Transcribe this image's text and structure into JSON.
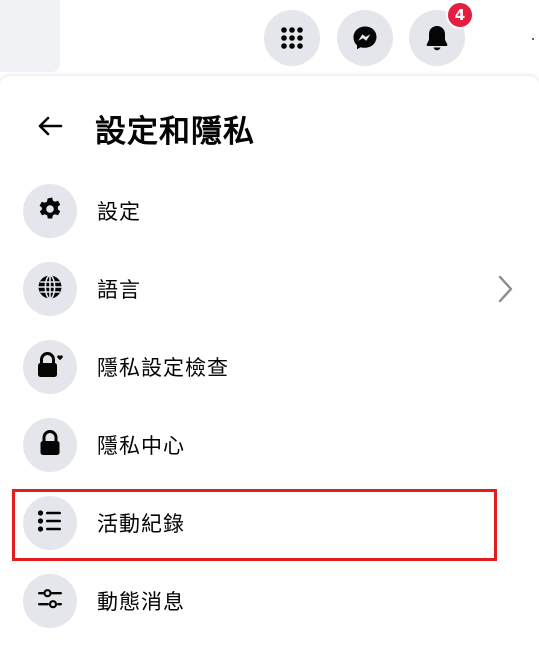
{
  "topbar": {
    "apps_icon": "grid-icon",
    "messenger_icon": "messenger-icon",
    "notifications_icon": "bell-icon",
    "notification_count": "4",
    "badge_color": "#e41e3f"
  },
  "panel": {
    "back_icon": "arrow-left-icon",
    "title": "設定和隱私",
    "items": [
      {
        "label": "設定",
        "icon": "gear-icon"
      },
      {
        "label": "語言",
        "icon": "globe-icon",
        "has_chevron": true
      },
      {
        "label": "隱私設定檢查",
        "icon": "lock-heart-icon"
      },
      {
        "label": "隱私中心",
        "icon": "lock-icon"
      },
      {
        "label": "活動紀錄",
        "icon": "list-icon",
        "highlighted": true
      },
      {
        "label": "動態消息",
        "icon": "sliders-icon"
      }
    ]
  },
  "colors": {
    "icon_bg": "#e4e6eb",
    "text": "#050505",
    "highlight": "#e11d1d"
  }
}
